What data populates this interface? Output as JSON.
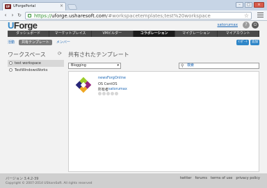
{
  "browser": {
    "tab_title": "UForgePortal",
    "tab_icon_text": "UF",
    "url_scheme": "https://",
    "url_host": "uforge.usharesoft.com",
    "url_path": "/#workspacetemplates;test%20workspace"
  },
  "header": {
    "logo_u": "U",
    "logo_rest": "Forge",
    "username": "satorumax"
  },
  "nav": {
    "items": [
      {
        "label": "ダッシュボード"
      },
      {
        "label": "マーケットプレイス"
      },
      {
        "label": "VMビルダー"
      },
      {
        "label": "コラボレーション"
      },
      {
        "label": "マイグレーション"
      },
      {
        "label": "マイアカウント"
      }
    ],
    "active_index": 3
  },
  "subnav": {
    "activity": "活動",
    "shared_templates": "共有テンプレート",
    "members": "メンバー"
  },
  "actions": {
    "import": "ｲﾝﾎﾟｰﾄ",
    "add": "追加"
  },
  "workspaces": {
    "title": "ワークスペース",
    "items": [
      {
        "label": "test workspace"
      },
      {
        "label": "TestWindowsWorks"
      }
    ],
    "selected_index": 0
  },
  "templates": {
    "title": "共有されたテンプレート",
    "filter_value": "Blogging",
    "search_placeholder": "検索",
    "cards": [
      {
        "name": "newsForgOnline",
        "os": "OS CentOS",
        "owner_label": "所有者",
        "owner": "satorumax",
        "rating": 0
      }
    ]
  },
  "footer": {
    "version": "バージョン 3.4.2-39",
    "copyright": "Copyright © 2007-2014 UShareSoft. All rights reserved",
    "links": [
      "twitter",
      "forums",
      "terms of use",
      "privacy policy"
    ]
  },
  "colors": {
    "accent": "#2f86c8",
    "nav_bg": "#4a4a4a",
    "nav_active": "#1b1b1b",
    "link": "#1a66b5"
  }
}
